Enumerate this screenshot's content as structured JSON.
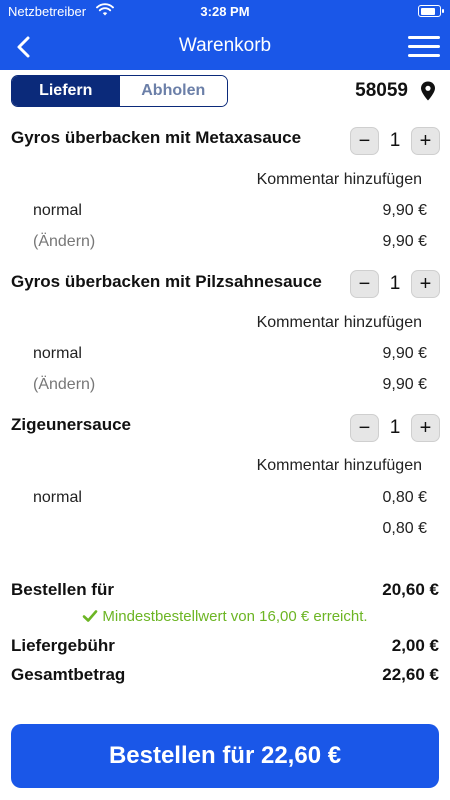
{
  "status": {
    "carrier": "Netzbetreiber",
    "time": "3:28 PM",
    "battery_level": 0.85
  },
  "header": {
    "title": "Warenkorb",
    "back_icon": "chevron-left-icon",
    "menu_icon": "hamburger-menu-icon"
  },
  "delivery": {
    "tabs": [
      "Liefern",
      "Abholen"
    ],
    "active_tab": "Liefern",
    "zip": "58059",
    "location_icon": "map-pin-icon"
  },
  "items": [
    {
      "name": "Gyros überbacken mit Metaxasauce",
      "quantity": "1",
      "comment_label": "Kommentar hinzufügen",
      "option": "normal",
      "option_price": "9,90 €",
      "change_label": "(Ändern)",
      "total": "9,90 €"
    },
    {
      "name": "Gyros überbacken mit Pilzsahnesauce",
      "quantity": "1",
      "comment_label": "Kommentar hinzufügen",
      "option": "normal",
      "option_price": "9,90 €",
      "change_label": "(Ändern)",
      "total": "9,90 €"
    },
    {
      "name": "Zigeunersauce",
      "quantity": "1",
      "comment_label": "Kommentar hinzufügen",
      "option": "normal",
      "option_price": "0,80 €",
      "total": "0,80 €"
    }
  ],
  "summary": {
    "subtotal_label": "Bestellen für",
    "subtotal": "20,60 €",
    "min_order_notice": "Mindestbestellwert von 16,00 € erreicht.",
    "delivery_fee_label": "Liefergebühr",
    "delivery_fee": "2,00 €",
    "total_label": "Gesamtbetrag",
    "total": "22,60 €"
  },
  "order_button": "Bestellen für 22,60 €",
  "colors": {
    "brand": "#1a57e8",
    "segment_active": "#0b2a7a",
    "success": "#6cb524"
  }
}
